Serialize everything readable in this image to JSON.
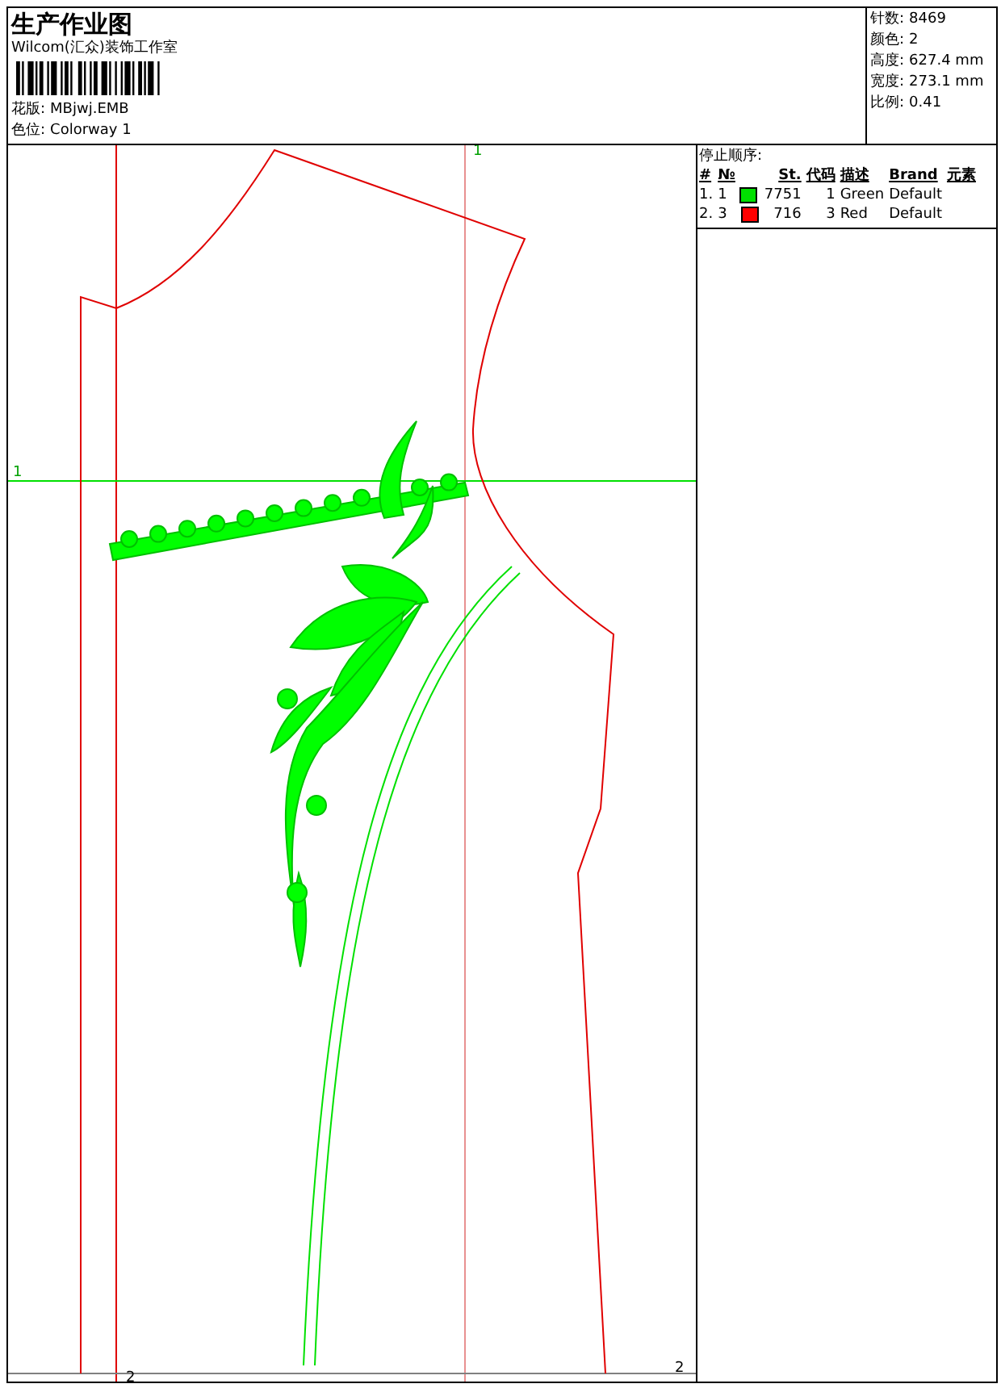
{
  "header": {
    "title": "生产作业图",
    "company": "Wilcom(汇众)装饰工作室",
    "fields": [
      {
        "label": "花版:",
        "value": "MBjwj.EMB"
      },
      {
        "label": "色位:",
        "value": "Colorway 1"
      }
    ]
  },
  "stats": [
    {
      "label": "针数:",
      "value": "8469"
    },
    {
      "label": "颜色:",
      "value": "2"
    },
    {
      "label": "高度:",
      "value": "627.4 mm"
    },
    {
      "label": "宽度:",
      "value": "273.1 mm"
    },
    {
      "label": "比例:",
      "value": "0.41"
    }
  ],
  "guides": [
    {
      "label": "1",
      "kind": "vertical"
    },
    {
      "label": "1",
      "kind": "horizontal"
    },
    {
      "label": "2",
      "kind": "bottom"
    },
    {
      "label": "2",
      "kind": "corner"
    }
  ],
  "stop_sequence": {
    "title": "停止顺序:",
    "columns": [
      "#",
      "№",
      "St.",
      "代码",
      "描述",
      "Brand",
      "元素"
    ],
    "rows": [
      {
        "cells": [
          "1.",
          "1",
          "7751",
          "1",
          "Green",
          "Default"
        ],
        "color": "#00e000"
      },
      {
        "cells": [
          "2.",
          "3",
          "716",
          "3",
          "Red",
          "Default"
        ],
        "color": "#ff0000"
      }
    ]
  }
}
